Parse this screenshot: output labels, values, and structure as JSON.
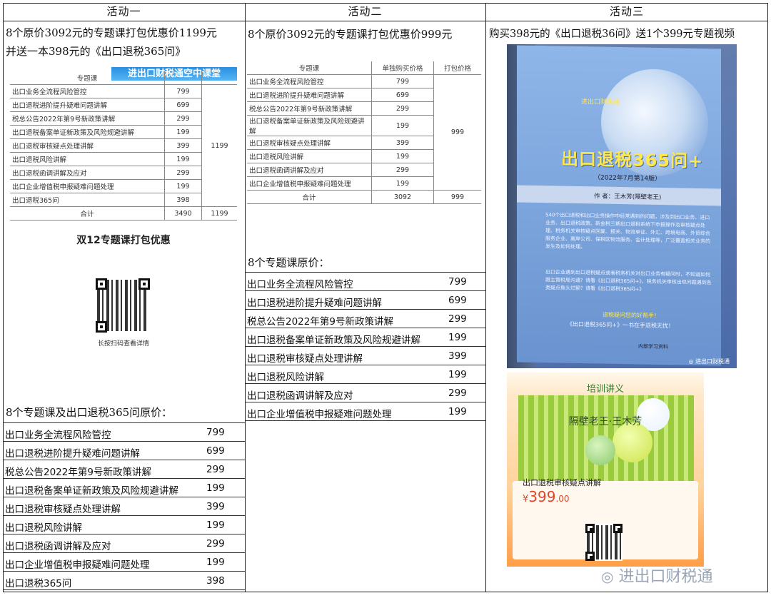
{
  "headers": [
    "活动一",
    "活动二",
    "活动三"
  ],
  "act1": {
    "desc_line1": "8个原价3092元的专题课打包优惠价1199元",
    "desc_line2": "并送一本398元的《出口退税365问》",
    "img_table": {
      "col_header": "专题课",
      "banner": "进出口财税通空中课堂",
      "rows": [
        {
          "name": "出口业务全流程风险管控",
          "price": "799"
        },
        {
          "name": "出口退税进阶提升疑难问题讲解",
          "price": "699"
        },
        {
          "name": "税总公告2022年第9号新政策讲解",
          "price": "299"
        },
        {
          "name": "出口退税备案单证新政策及风险规避讲解",
          "price": "199"
        },
        {
          "name": "出口退税审核疑点处理讲解",
          "price": "399"
        },
        {
          "name": "出口退税风险讲解",
          "price": "199"
        },
        {
          "name": "出口退税函调讲解及应对",
          "price": "299"
        },
        {
          "name": "出口企业增值税申报疑难问题处理",
          "price": "199"
        },
        {
          "name": "出口退税365问",
          "price": "398"
        }
      ],
      "pack_price": "1199",
      "total_label": "合计",
      "total_price": "3490",
      "total_pack": "1199"
    },
    "promo_title": "双12专题课打包优惠",
    "promo_caption": "长按扫码查看详情",
    "list_title": "8个专题课及出口退税365问原价：",
    "list": [
      {
        "name": "出口业务全流程风险管控",
        "price": "799"
      },
      {
        "name": "出口退税进阶提升疑难问题讲解",
        "price": "699"
      },
      {
        "name": "税总公告2022年第9号新政策讲解",
        "price": "299"
      },
      {
        "name": "出口退税备案单证新政策及风险规避讲解",
        "price": "199"
      },
      {
        "name": "出口退税审核疑点处理讲解",
        "price": "399"
      },
      {
        "name": "出口退税风险讲解",
        "price": "199"
      },
      {
        "name": "出口退税函调讲解及应对",
        "price": "299"
      },
      {
        "name": "出口企业增值税申报疑难问题处理",
        "price": "199"
      },
      {
        "name": "出口退税365问",
        "price": "398"
      }
    ]
  },
  "act2": {
    "desc": "8个原价3092元的专题课打包优惠价999元",
    "img_table": {
      "col_headers": [
        "专题课",
        "单独购买价格",
        "打包价格"
      ],
      "rows": [
        {
          "name": "出口业务全流程风险管控",
          "price": "799"
        },
        {
          "name": "出口退税进阶提升疑难问题讲解",
          "price": "699"
        },
        {
          "name": "税总公告2022年第9号新政策讲解",
          "price": "299"
        },
        {
          "name": "出口退税备案单证新政策及风险规避讲解",
          "price": "199"
        },
        {
          "name": "出口退税审核疑点处理讲解",
          "price": "399"
        },
        {
          "name": "出口退税风险讲解",
          "price": "199"
        },
        {
          "name": "出口退税函调讲解及应对",
          "price": "299"
        },
        {
          "name": "出口企业增值税申报疑难问题处理",
          "price": "199"
        }
      ],
      "pack_price": "999",
      "total_label": "合计",
      "total_price": "3092",
      "total_pack": "999"
    },
    "list_title": "8个专题课原价：",
    "list": [
      {
        "name": "出口业务全流程风险管控",
        "price": "799"
      },
      {
        "name": "出口退税进阶提升疑难问题讲解",
        "price": "699"
      },
      {
        "name": "税总公告2022年第9号新政策讲解",
        "price": "299"
      },
      {
        "name": "出口退税备案单证新政策及风险规避讲解",
        "price": "199"
      },
      {
        "name": "出口退税审核疑点处理讲解",
        "price": "399"
      },
      {
        "name": "出口退税风险讲解",
        "price": "199"
      },
      {
        "name": "出口退税函调讲解及应对",
        "price": "299"
      },
      {
        "name": "出口企业增值税申报疑难问题处理",
        "price": "199"
      }
    ]
  },
  "act3": {
    "desc": "购买398元的《出口退税36问》送1个399元专题视频",
    "book": {
      "series": "进出口财税通",
      "title": "出口退税365问+",
      "edition": "（2022年7月第14版）",
      "author": "作  者：王木芳(隔壁老王)",
      "blurb": "540个出口退税和出口业务操作中经常遇到的问题，涉及到出口业务、进口业务、出口退税政策、新金税三期出口退税系统下申报操作及审核疑点处理、税务机关审核疑点回复、报关、物流单证、外汇、跨境电商、外贸综合服务企业、离岸公司、保税区物流服务、会计处理等，广泛覆盖相关业务的发生及如何处理。",
      "blurb2": "出口企业遇到出口退税疑点或者税务机关对出口业务有疑问时，不知道如何跟主管税局沟通？请看《出口退税365问+》，税务机关审核出现问题遇到各类疑点焦头烂额？请看《出口退税365问+》",
      "line3": "退税疑问您的好帮手！",
      "line4": "《出口退税365问+》一书在手退税无忧！",
      "footer": "内部学习资料",
      "wechat": "进出口财税通"
    },
    "course": {
      "top_label": "培训讲义",
      "teacher": "隔壁老王·王木芳",
      "title": "出口退税审核疑点讲解",
      "price_symbol": "¥",
      "price_int": "399",
      "price_dec": ".00"
    },
    "watermark": "进出口财税通"
  }
}
